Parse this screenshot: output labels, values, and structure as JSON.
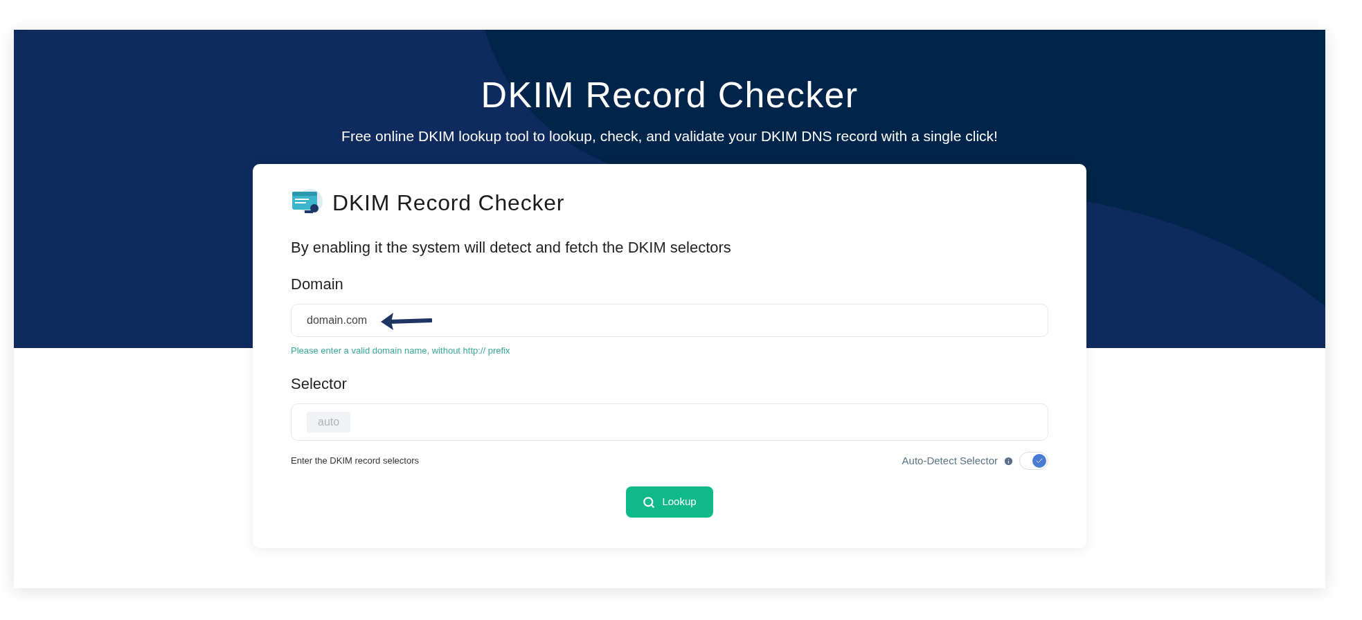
{
  "hero": {
    "title": "DKIM Record Checker",
    "subtitle": "Free online DKIM lookup tool to lookup, check, and validate your DKIM DNS record with a single click!"
  },
  "card": {
    "title": "DKIM Record Checker",
    "description": "By enabling it the system will detect and fetch the DKIM selectors",
    "domain": {
      "label": "Domain",
      "value": "domain.com",
      "hint": "Please enter a valid domain name, without http:// prefix"
    },
    "selector": {
      "label": "Selector",
      "chips": [
        "auto"
      ],
      "hint": "Enter the DKIM record selectors",
      "auto_detect": {
        "label": "Auto-Detect Selector",
        "on": true
      }
    },
    "button": "Lookup"
  }
}
